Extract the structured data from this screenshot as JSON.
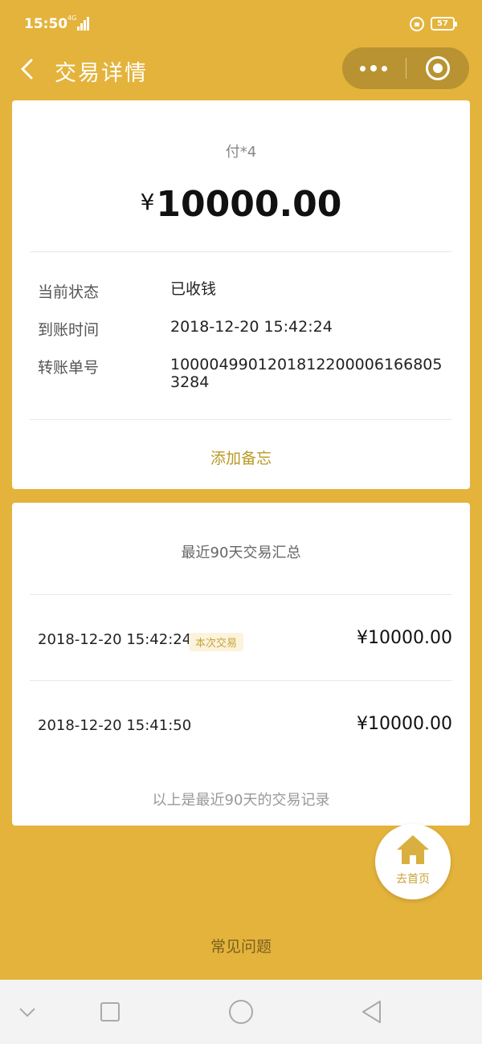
{
  "status_bar": {
    "time": "15:50",
    "network": "4G",
    "battery": "57"
  },
  "nav": {
    "title": "交易详情",
    "back_icon": "chevron-left-icon",
    "more_icon": "more-dots-icon",
    "close_icon": "target-circle-icon"
  },
  "detail": {
    "payer": "付*4",
    "currency": "¥",
    "amount": "10000.00",
    "rows": [
      {
        "label": "当前状态",
        "value": "已收钱"
      },
      {
        "label": "到账时间",
        "value": "2018-12-20 15:42:24"
      },
      {
        "label": "转账单号",
        "value": "10000499012018122000061668053284"
      }
    ],
    "memo_link": "添加备忘"
  },
  "summary": {
    "title": "最近90天交易汇总",
    "transactions": [
      {
        "time": "2018-12-20 15:42:24",
        "tag": "本次交易",
        "amount": "¥10000.00"
      },
      {
        "time": "2018-12-20 15:41:50",
        "tag": "",
        "amount": "¥10000.00"
      }
    ],
    "footer": "以上是最近90天的交易记录"
  },
  "home_button": {
    "label": "去首页",
    "icon": "home-icon"
  },
  "faq_link": "常见问题",
  "colors": {
    "background": "#e4b33c",
    "accent": "#c9a43a",
    "card": "#ffffff"
  }
}
